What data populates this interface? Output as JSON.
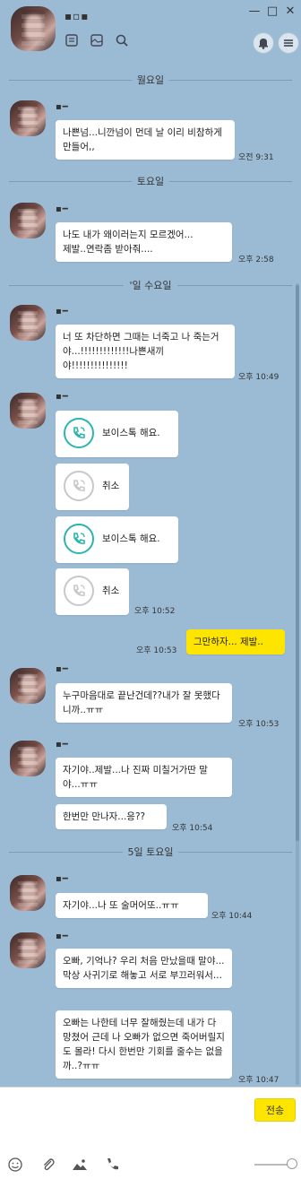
{
  "header": {
    "chat_title": "▪▫▪",
    "window_controls": {
      "minimize": "—",
      "maximize": "□",
      "close": "✕"
    },
    "icons": [
      "list-icon",
      "gallery-icon",
      "search-icon",
      "bell-icon",
      "menu-icon"
    ]
  },
  "separators": {
    "mon": "월요일",
    "sat1": "토요일",
    "wed": "'일 수요일",
    "sat5": "5일 토요일"
  },
  "sender_name": "▪━",
  "messages": {
    "m1": {
      "text": "나쁜넘...니깐넘이 먼데 날 이리 비참하게 만들어,,",
      "time": "오전 9:31"
    },
    "m2": {
      "text": "나도 내가 왜이러는지 모르겠어...\n제발..연락좀 받아줘....",
      "time": "오후 2:58"
    },
    "m3": {
      "text": "너 또 차단하면 그때는 너죽고 나 죽는거야...!!!!!!!!!!!!!나쁜새끼야!!!!!!!!!!!!!!!",
      "time": "오후 10:49"
    },
    "v1": {
      "label": "보이스톡 해요."
    },
    "v2": {
      "label": "취소"
    },
    "v3": {
      "label": "보이스톡 해요."
    },
    "v4": {
      "label": "취소",
      "time": "오후 10:52"
    },
    "me1": {
      "text": "그만하자... 제발..",
      "time": "오후 10:53"
    },
    "m4": {
      "text": "누구마음대로 끝난건데??내가 잘 못했다니까..ㅠㅠ",
      "time": "오후 10:53"
    },
    "m5": {
      "text": "자기야..제발...나 진짜 미칠거가딴 말야...ㅠㅠ"
    },
    "m6": {
      "text": "한번만 만나자...응??",
      "time": "오후 10:54"
    },
    "m7": {
      "text": "자기야...나 또 술머어또..ㅠㅠ",
      "time": "오후 10:44"
    },
    "m8": {
      "text": "오빠, 기억나? 우리 처음 만났을때 말야... 막상 사귀기로 해놓고 서로 부끄러워서..."
    },
    "m9": {
      "text": "오빠는 나한테 너무 잘해줬는데 내가 다 망쳤어 근데 나 오빠가 없으면 죽어버릴지도 몰라! 다시 한번만 기회를 줄수는 없을까..?ㅠㅠ",
      "time": "오후 10:47"
    }
  },
  "input": {
    "send_label": "전송"
  },
  "colors": {
    "background": "#9bbbd4",
    "my_bubble": "#fee500",
    "voice_accent": "#2bb5b0"
  }
}
